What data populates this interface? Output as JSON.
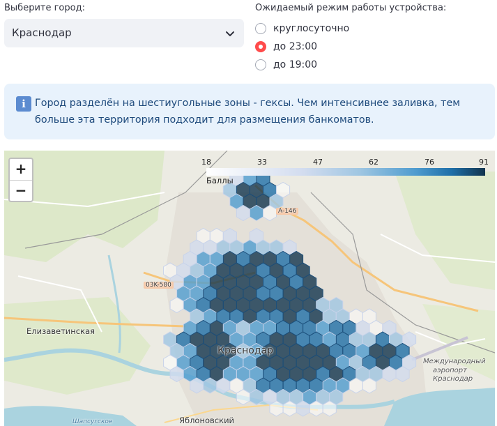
{
  "city_select": {
    "label": "Выберите город:",
    "value": "Краснодар"
  },
  "mode": {
    "label": "Ожидаемый режим работы устройства:",
    "options": [
      "круглосуточно",
      "до 23:00",
      "до 19:00"
    ],
    "selected_index": 1
  },
  "info": {
    "icon": "info-icon",
    "text": "Город разделён на шестиугольные зоны - гексы. Чем интенсивнее заливка, тем больше эта территория подходит для размещения банкоматов."
  },
  "map": {
    "zoom_in": "+",
    "zoom_out": "−",
    "legend": {
      "ticks": [
        "18",
        "33",
        "47",
        "62",
        "76",
        "91"
      ],
      "title": "Баллы",
      "colors": [
        "#ffffff",
        "#d2dcef",
        "#9fc6e2",
        "#4f9ccf",
        "#1f6fa8",
        "#12344d"
      ]
    },
    "labels": {
      "elizavetinskaya": "Елизаветинская",
      "krasnodar": "Краснодар",
      "yablonovsky": "Яблоновский",
      "shapsugskoe": "Шапсугское",
      "airport_1": "Международный",
      "airport_2": "аэропорт",
      "airport_3": "Краснодар",
      "road_a146": "A-146",
      "road_03k": "03K-580"
    }
  },
  "colors": {
    "accent": "#ff4b4b",
    "info_bg": "#e8f2fc",
    "info_text": "#1e4a7c"
  }
}
